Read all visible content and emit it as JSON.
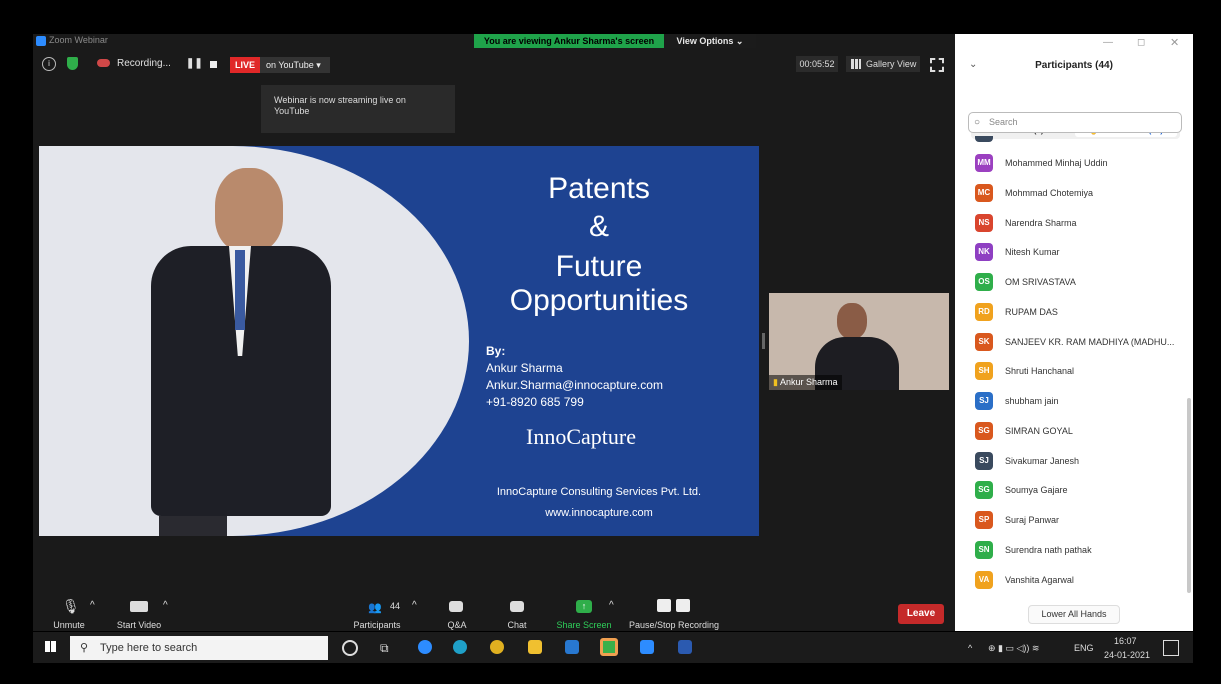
{
  "titlebar": {
    "app_title": "Zoom Webinar",
    "viewing_banner": "You are viewing Ankur Sharma's screen",
    "view_options": "View Options ⌄"
  },
  "toolbar": {
    "recording": "Recording...",
    "live": "LIVE",
    "live_platform": "on YouTube ▾",
    "timer": "00:05:52",
    "gallery_view": "Gallery View"
  },
  "tooltip": "Webinar is now streaming live on YouTube",
  "slide": {
    "title_lines": [
      "Patents",
      "&",
      "Future",
      "Opportunities"
    ],
    "by": "By:",
    "author": "Ankur Sharma",
    "email": "Ankur.Sharma@innocapture.com",
    "phone": "+91-8920 685 799",
    "brand": "InnoCapture",
    "company": "InnoCapture Consulting Services Pvt. Ltd.",
    "website": "www.innocapture.com"
  },
  "video": {
    "name": "Ankur Sharma"
  },
  "bottom_bar": {
    "unmute": "Unmute",
    "start_video": "Start Video",
    "participants": "Participants",
    "participants_count": "44",
    "qa": "Q&A",
    "chat": "Chat",
    "share_screen": "Share Screen",
    "pause_recording": "Pause/Stop Recording",
    "leave": "Leave"
  },
  "panel": {
    "title": "Participants (44)",
    "tab_panelists": "Panelists (4)",
    "hands_count": "3",
    "tab_attendees": "Attendees (40)",
    "search_placeholder": "Search",
    "lower_all_hands": "Lower All Hands",
    "participants": [
      {
        "initials": "MM",
        "name": "Mohammed Minhaj Uddin",
        "color": "#9b40c0"
      },
      {
        "initials": "MC",
        "name": "Mohmmad Chotemiya",
        "color": "#d9581e"
      },
      {
        "initials": "NS",
        "name": "Narendra Sharma",
        "color": "#d9452e"
      },
      {
        "initials": "NK",
        "name": "Nitesh Kumar",
        "color": "#8e3fc2"
      },
      {
        "initials": "OS",
        "name": "OM SRIVASTAVA",
        "color": "#2fae4a"
      },
      {
        "initials": "RD",
        "name": "RUPAM DAS",
        "color": "#f0a21e"
      },
      {
        "initials": "SK",
        "name": "SANJEEV KR. RAM MADHIYA (MADHU...",
        "color": "#d9581e"
      },
      {
        "initials": "SH",
        "name": "Shruti Hanchanal",
        "color": "#f0a21e"
      },
      {
        "initials": "SJ",
        "name": "shubham jain",
        "color": "#2b6fc7"
      },
      {
        "initials": "SG",
        "name": "SIMRAN GOYAL",
        "color": "#d9581e"
      },
      {
        "initials": "SJ",
        "name": "Sivakumar Janesh",
        "color": "#3a4a5e"
      },
      {
        "initials": "SG",
        "name": "Soumya Gajare",
        "color": "#2fae4a"
      },
      {
        "initials": "SP",
        "name": "Suraj Panwar",
        "color": "#d9581e"
      },
      {
        "initials": "SN",
        "name": "Surendra nath pathak",
        "color": "#2fae4a"
      },
      {
        "initials": "VA",
        "name": "Vanshita Agarwal",
        "color": "#f0a21e"
      }
    ]
  },
  "taskbar": {
    "search_placeholder": "Type here to search",
    "language": "ENG",
    "time": "16:07",
    "date": "24-01-2021"
  }
}
